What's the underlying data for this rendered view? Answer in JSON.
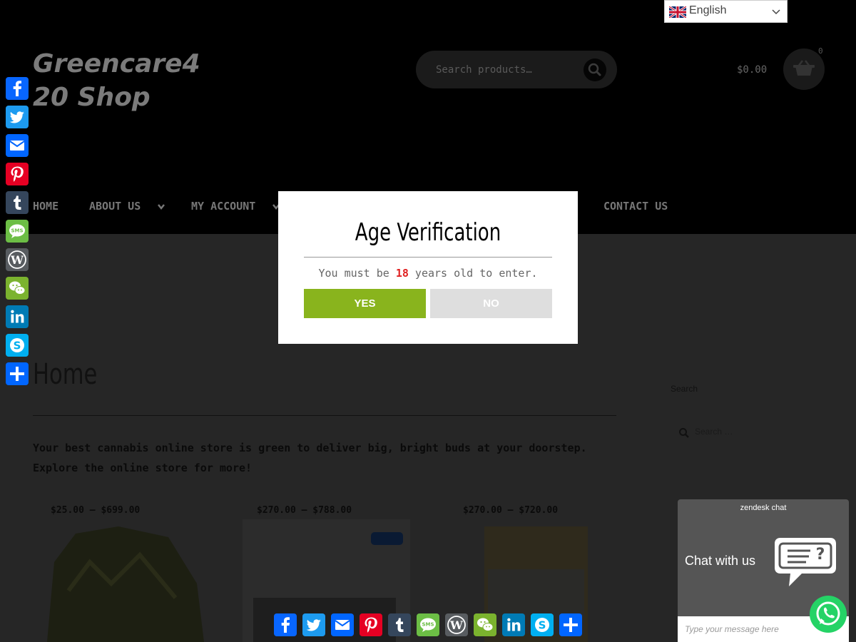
{
  "header": {
    "logo_line1": "Greencare4",
    "logo_line2": "20 Shop",
    "search_placeholder": "Search products…",
    "cart_total": "$0.00",
    "cart_count": "0"
  },
  "language": {
    "label": "English"
  },
  "nav": {
    "items": [
      {
        "label": "HOME"
      },
      {
        "label": "ABOUT US"
      },
      {
        "label": "MY ACCOUNT"
      },
      {
        "label": "CONTACT US"
      }
    ]
  },
  "content": {
    "page_title": "Home",
    "intro": "Your best cannabis online store is green to deliver big, bright buds at your doorstep. Explore the online store for more!",
    "products": [
      {
        "price": "$25.00 – $699.00"
      },
      {
        "price": "$270.00 – $788.00"
      },
      {
        "price": "$270.00 – $720.00"
      }
    ]
  },
  "sidebar": {
    "search_label": "Search",
    "search_placeholder": "Search …"
  },
  "modal": {
    "title": "Age Verification",
    "msg_before": "You must be ",
    "age": "18",
    "msg_after": " years old to enter.",
    "yes_label": "YES",
    "no_label": "NO"
  },
  "share": {
    "services": [
      "Facebook",
      "Twitter",
      "Email",
      "Pinterest",
      "Tumblr",
      "SMS",
      "WordPress",
      "WeChat",
      "LinkedIn",
      "Skype",
      "Share"
    ],
    "colors": {
      "facebook": "#0866ff",
      "twitter": "#1d9bf0",
      "email": "#888",
      "pinterest": "#e60023",
      "tumblr": "#35465c",
      "sms": "#6cbe45",
      "wordpress": "#585c60",
      "wechat": "#7bb32e",
      "linkedin": "#007bb5",
      "skype": "#00aff0",
      "share": "#0166ff"
    }
  },
  "chat": {
    "brand": "zendesk chat",
    "title": "Chat with us",
    "placeholder": "Type your message here"
  },
  "colors": {
    "accent_green": "#89b41d",
    "age_red": "#e02020"
  }
}
